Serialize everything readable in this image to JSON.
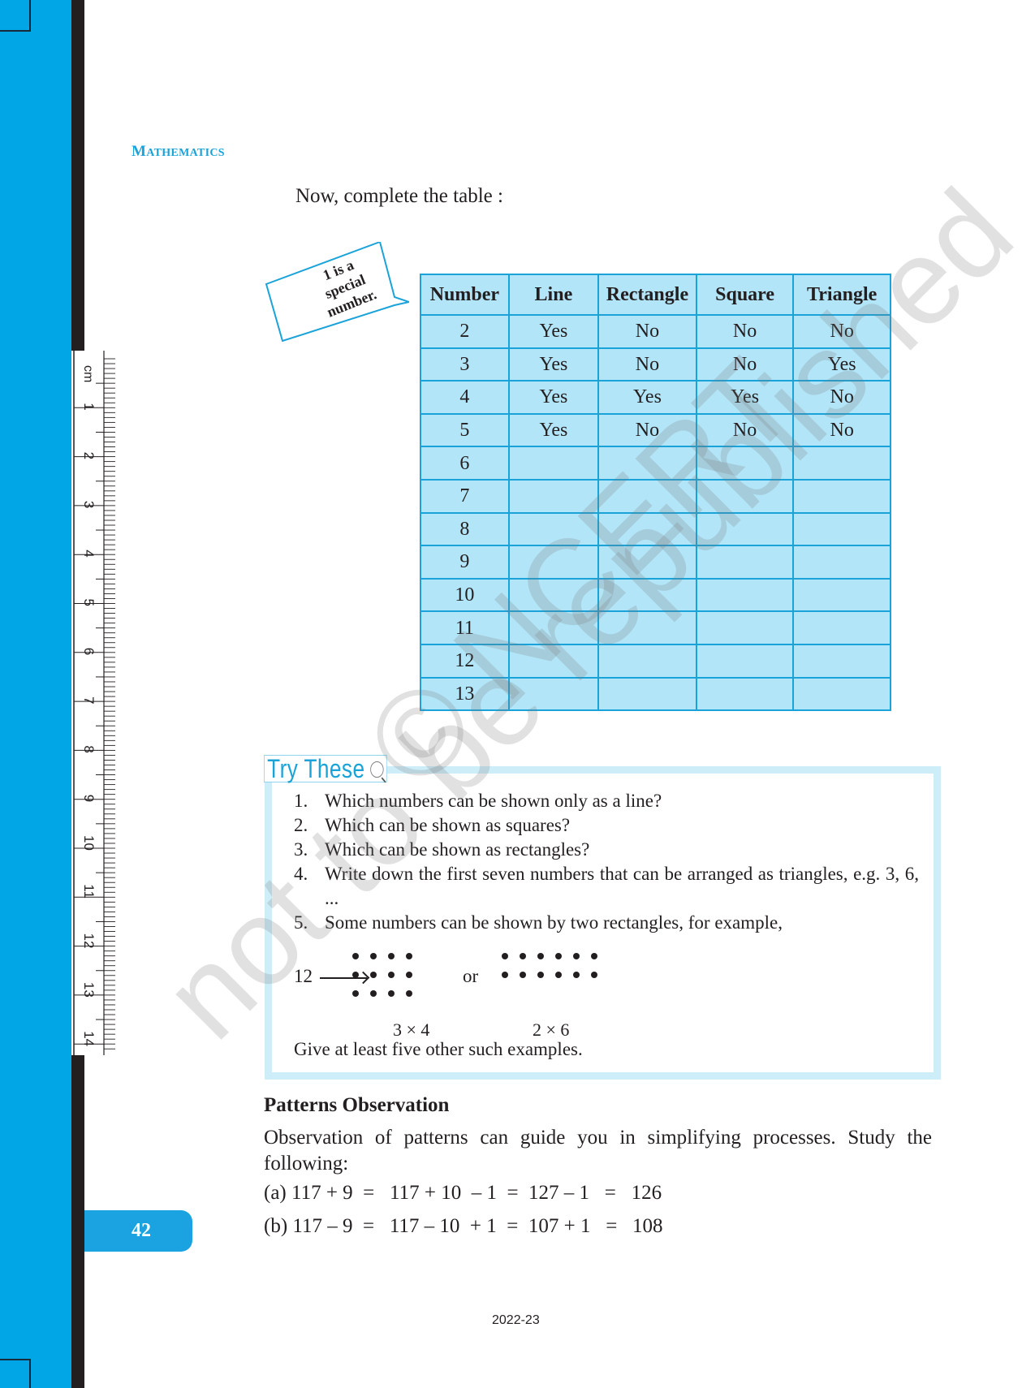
{
  "header": {
    "running_head_cap": "M",
    "running_head_rest": "ATHEMATICS"
  },
  "intro_text": "Now, complete the table :",
  "callout": {
    "line1": "1 is a",
    "line2": "special",
    "line3": "number."
  },
  "table": {
    "columns": [
      "Number",
      "Line",
      "Rectangle",
      "Square",
      "Triangle"
    ],
    "rows": [
      [
        "2",
        "Yes",
        "No",
        "No",
        "No"
      ],
      [
        "3",
        "Yes",
        "No",
        "No",
        "Yes"
      ],
      [
        "4",
        "Yes",
        "Yes",
        "Yes",
        "No"
      ],
      [
        "5",
        "Yes",
        "No",
        "No",
        "No"
      ],
      [
        "6",
        "",
        "",
        "",
        ""
      ],
      [
        "7",
        "",
        "",
        "",
        ""
      ],
      [
        "8",
        "",
        "",
        "",
        ""
      ],
      [
        "9",
        "",
        "",
        "",
        ""
      ],
      [
        "10",
        "",
        "",
        "",
        ""
      ],
      [
        "11",
        "",
        "",
        "",
        ""
      ],
      [
        "12",
        "",
        "",
        "",
        ""
      ],
      [
        "13",
        "",
        "",
        "",
        ""
      ]
    ]
  },
  "try_these": {
    "title": "Try These",
    "icon": "magnifier-icon",
    "questions": [
      {
        "num": "1.",
        "text": "Which numbers can be shown only as a line?"
      },
      {
        "num": "2.",
        "text": "Which can be shown as squares?"
      },
      {
        "num": "3.",
        "text": "Which can be shown as rectangles?"
      },
      {
        "num": "4.",
        "text": "Write down the first seven numbers that can be arranged as triangles, e.g. 3, 6, ..."
      },
      {
        "num": "5.",
        "text": "Some numbers can be shown by two rectangles, for example,"
      }
    ],
    "example": {
      "number": "12",
      "connector": "or",
      "arrangement1": {
        "rows": 3,
        "cols": 4,
        "label": "3 × 4"
      },
      "arrangement2": {
        "rows": 2,
        "cols": 6,
        "label": "2 × 6"
      }
    },
    "footer": "Give at least five other such examples."
  },
  "patterns": {
    "heading": "Patterns Observation",
    "paragraph": "Observation of patterns can guide you in simplifying processes. Study the following:",
    "equations": [
      "(a) 117 + 9  =   117 + 10  – 1  =  127 – 1   =   126",
      "(b) 117 – 9  =   117 – 10  + 1  =  107 + 1   =   108"
    ]
  },
  "ruler": {
    "unit": "cm",
    "labels": [
      "1",
      "2",
      "3",
      "4",
      "5",
      "6",
      "7",
      "8",
      "9",
      "10",
      "11",
      "12",
      "13",
      "14"
    ]
  },
  "page_number": "42",
  "footer_year": "2022-23",
  "watermark": {
    "line1": "© NCERT",
    "line2": "not to be republished"
  },
  "colors": {
    "accent_blue": "#00a6e6",
    "table_fill": "#b3e5f8",
    "table_border": "#1aa3d9",
    "box_border": "#cdeef9"
  }
}
